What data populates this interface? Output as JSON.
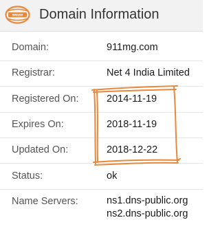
{
  "header": {
    "title": "Domain Information",
    "icon": "www-globe-icon",
    "icon_text": "www",
    "accent_color": "#e8883a"
  },
  "rows": [
    {
      "label": "Domain:",
      "value": "911mg.com"
    },
    {
      "label": "Registrar:",
      "value": "Net 4 India Limited"
    },
    {
      "label": "Registered On:",
      "value": "2014-11-19"
    },
    {
      "label": "Expires On:",
      "value": "2018-11-19"
    },
    {
      "label": "Updated On:",
      "value": "2018-12-22"
    },
    {
      "label": "Status:",
      "value": "ok"
    }
  ],
  "name_servers": {
    "label": "Name Servers:",
    "values": [
      "ns1.dns-public.org",
      "ns2.dns-public.org"
    ]
  },
  "annotation_color": "#e8883a"
}
